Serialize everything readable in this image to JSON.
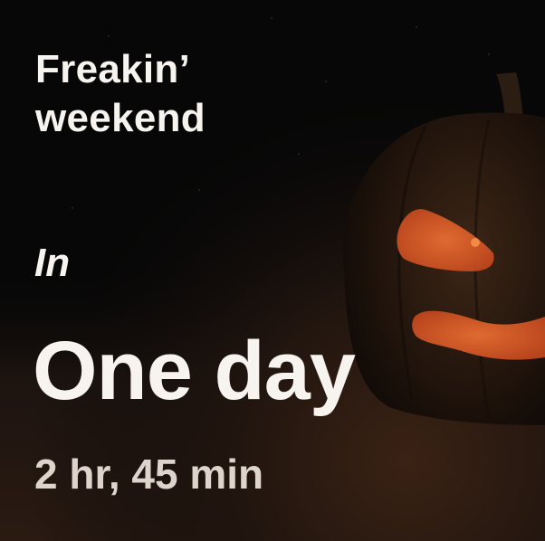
{
  "widget": {
    "title_line1": "Freakin’",
    "title_line2": "weekend",
    "prefix": "In",
    "main_countdown": "One day",
    "detail_countdown": "2 hr, 45 min",
    "background_image": "jack-o-lantern",
    "colors": {
      "text": "#f7f4ef",
      "subtext": "#ddd5cc",
      "glow": "#d9582a",
      "background": "#070707"
    }
  }
}
